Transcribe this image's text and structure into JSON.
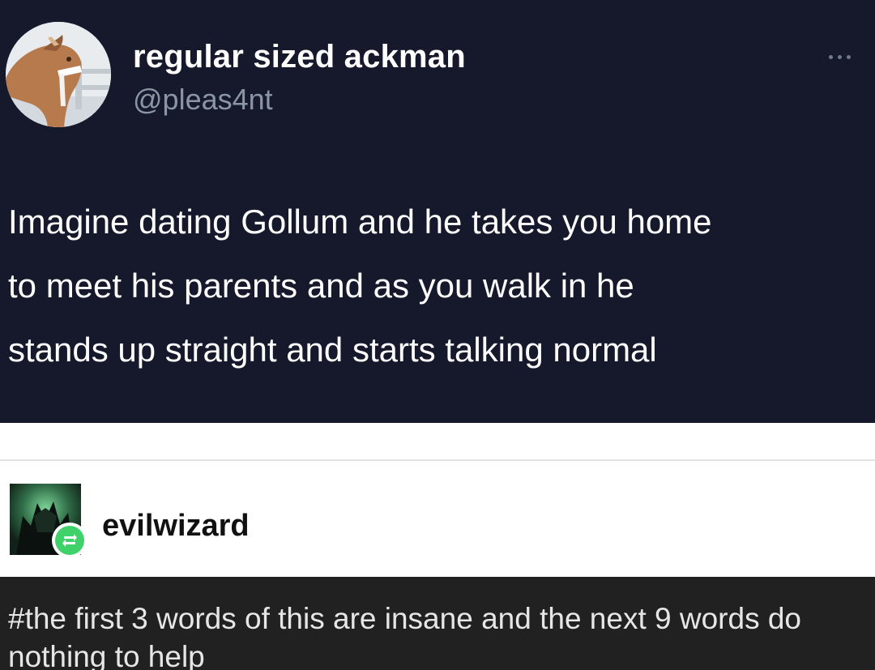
{
  "tweet": {
    "display_name": "regular sized ackman",
    "handle": "@pleas4nt",
    "avatar_icon": "horse-icon",
    "more_icon": "more-dots-icon",
    "body": "Imagine dating Gollum and he takes you home\nto meet his parents and as you walk in he\nstands up straight and starts talking normal"
  },
  "reblog": {
    "username": "evilwizard",
    "avatar_icon": "dark-figure-icon",
    "badge_icon": "reblog-icon",
    "badge_color": "#3fd26b"
  },
  "tags": {
    "text": "#the first 3 words of this are insane and the next 9 words do nothing to help"
  },
  "colors": {
    "tweet_background": "#15192b",
    "tags_background": "#212121",
    "handle_text": "#8b96a3"
  }
}
